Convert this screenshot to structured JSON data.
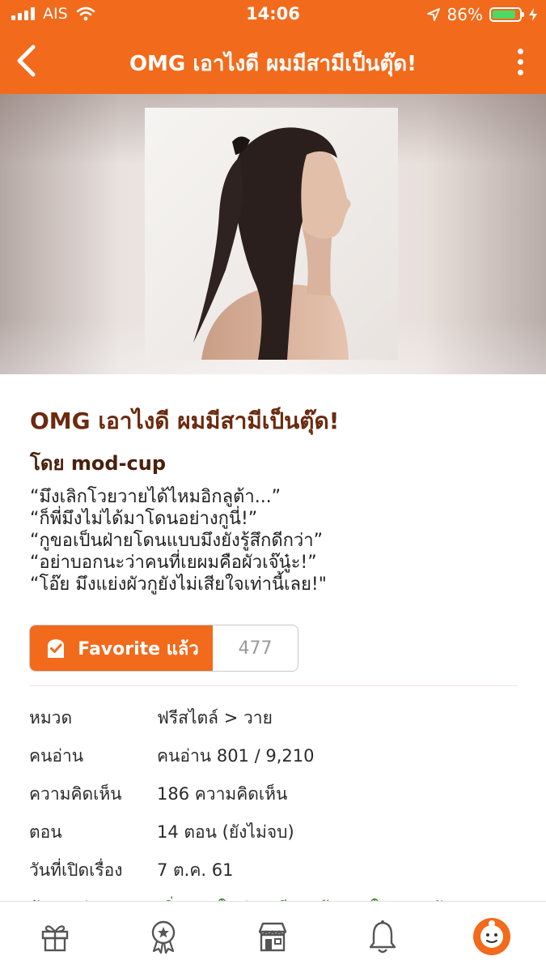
{
  "status_bar": {
    "carrier": "AIS",
    "time": "14:06",
    "battery_percent": "86%",
    "battery_level": 0.86
  },
  "nav": {
    "title": "OMG เอาไงดี ผมมีสามีเป็นตุ๊ด!"
  },
  "story": {
    "title": "OMG เอาไงดี ผมมีสามีเป็นตุ๊ด!",
    "author": "โดย mod-cup",
    "synopsis": [
      "“มึงเลิกโวยวายได้ไหมอิกลูต้า...”",
      "“ก็พี่มึงไม่ได้มาโดนอย่างกูนี่!”",
      "“กูขอเป็นฝ่ายโดนแบบมึงยังรู้สึกดีกว่า”",
      "“อย่าบอกนะว่าคนที่เยผมคือผัวเจ๊นู๋ะ!”",
      "“โอ๊ย มึงแย่งผัวกูยังไม่เสียใจเท่านี้เลย!\""
    ]
  },
  "favorite": {
    "label": "Favorite แล้ว",
    "count": "477"
  },
  "info": [
    {
      "label": "หมวด",
      "value": "ฟรีสไตล์ > วาย"
    },
    {
      "label": "คนอ่าน",
      "value": "คนอ่าน 801 / 9,210"
    },
    {
      "label": "ความคิดเห็น",
      "value": "186 ความคิดเห็น"
    },
    {
      "label": "ตอน",
      "value": "14 ตอน (ยังไม่จบ)"
    },
    {
      "label": "วันที่เปิดเรื่อง",
      "value": "7 ต.ค. 61"
    },
    {
      "label": "อัปเดตล่าสุด",
      "value": "เพิ่มตอนใหม่ \"เตรียมพร้อมรบในสนามรัก\""
    }
  ],
  "colors": {
    "brand_orange": "#f26a1b",
    "title_brown": "#6b2a0f",
    "update_green": "#3a8a2a",
    "battery_green": "#4cd964"
  },
  "tabs": [
    {
      "icon": "gift-icon"
    },
    {
      "icon": "award-badge-icon"
    },
    {
      "icon": "store-icon"
    },
    {
      "icon": "bell-icon"
    },
    {
      "icon": "profile-avatar-icon"
    }
  ]
}
